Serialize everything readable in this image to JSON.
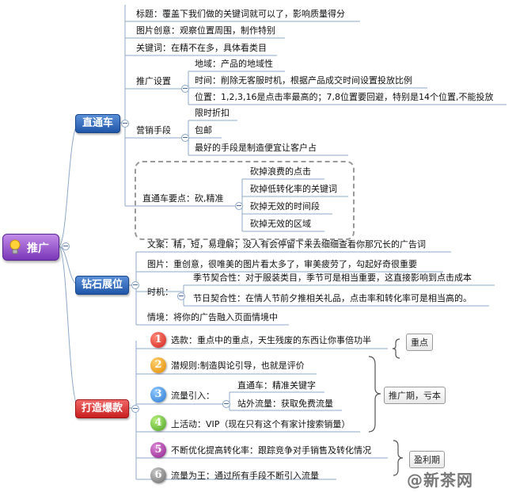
{
  "root": {
    "label": "推广"
  },
  "branches": {
    "zhitongche": {
      "label": "直通车",
      "items": {
        "title": "标题：覆盖下我们做的关键词就可以了，影响质量得分",
        "image": "图片创意：观察位置周围，制作特别",
        "keyword": "关键词：在精不在多，具体看类目",
        "promo": {
          "label": "推广设置",
          "region": "地域：产品的地域性",
          "time": "时间：削除无客服时机，根据产品成交时间设置投放比例",
          "position": "位置：1,2,3,16是点击率最高的；7,8位置要回避，特别是14个位置,不能投放"
        },
        "marketing": {
          "label": "营销手段",
          "a": "限时折扣",
          "b": "包邮",
          "c": "最好的手段是制造便宜让客户占"
        },
        "key": {
          "label": "直通车要点：砍,精准",
          "a": "砍掉浪费的点击",
          "b": "砍掉低转化率的关键词",
          "c": "砍掉无效的时间段",
          "d": "砍掉无效的区域"
        }
      }
    },
    "zuanshi": {
      "label": "钻石展位",
      "items": {
        "copy": "文案：精，短，易理解；没人有会停留下来去细细查看你那冗长的广告词",
        "image": "图片：重创意，很唯美的图片看太多了，审美疲劳了，勾起好奇很重要",
        "timing": {
          "label": "时机：",
          "a": "季节契合性：对于服装类目，季节可是相当重要，这直接影响到点击成本",
          "b": "节日契合性：在情人节前夕推相关礼品，点击率和转化率可是相当高的。"
        },
        "context": "情境：将你的广告融入页面情境中"
      }
    },
    "baokuan": {
      "label": "打造爆款",
      "steps": [
        {
          "num": "1",
          "text": "选款：重点中的重点，天生残废的东西让你事倍功半"
        },
        {
          "num": "2",
          "text": "潜规则:制造舆论引导，也就是评价"
        },
        {
          "num": "3",
          "text": "流量引入：",
          "subs": [
            "直通车：精准关键字",
            "站外流量：获取免费流量"
          ]
        },
        {
          "num": "4",
          "text": "上活动：VIP（现在只有这个有家计搜索销量）"
        },
        {
          "num": "5",
          "text": "不断优化提高转化率：跟踪竞争对手销售及转化情况"
        },
        {
          "num": "6",
          "text": "流量为王：通过所有手段不断引入流量"
        }
      ],
      "callouts": {
        "focus": "重点",
        "promo_period": "推广期，亏本",
        "profit_period": "盈利期"
      }
    }
  },
  "watermark": "@新茶网",
  "colors": {
    "blue": "#1f56a8",
    "red": "#c81e1e",
    "purple": "#7a36b8",
    "line": "#8fa8c8"
  }
}
